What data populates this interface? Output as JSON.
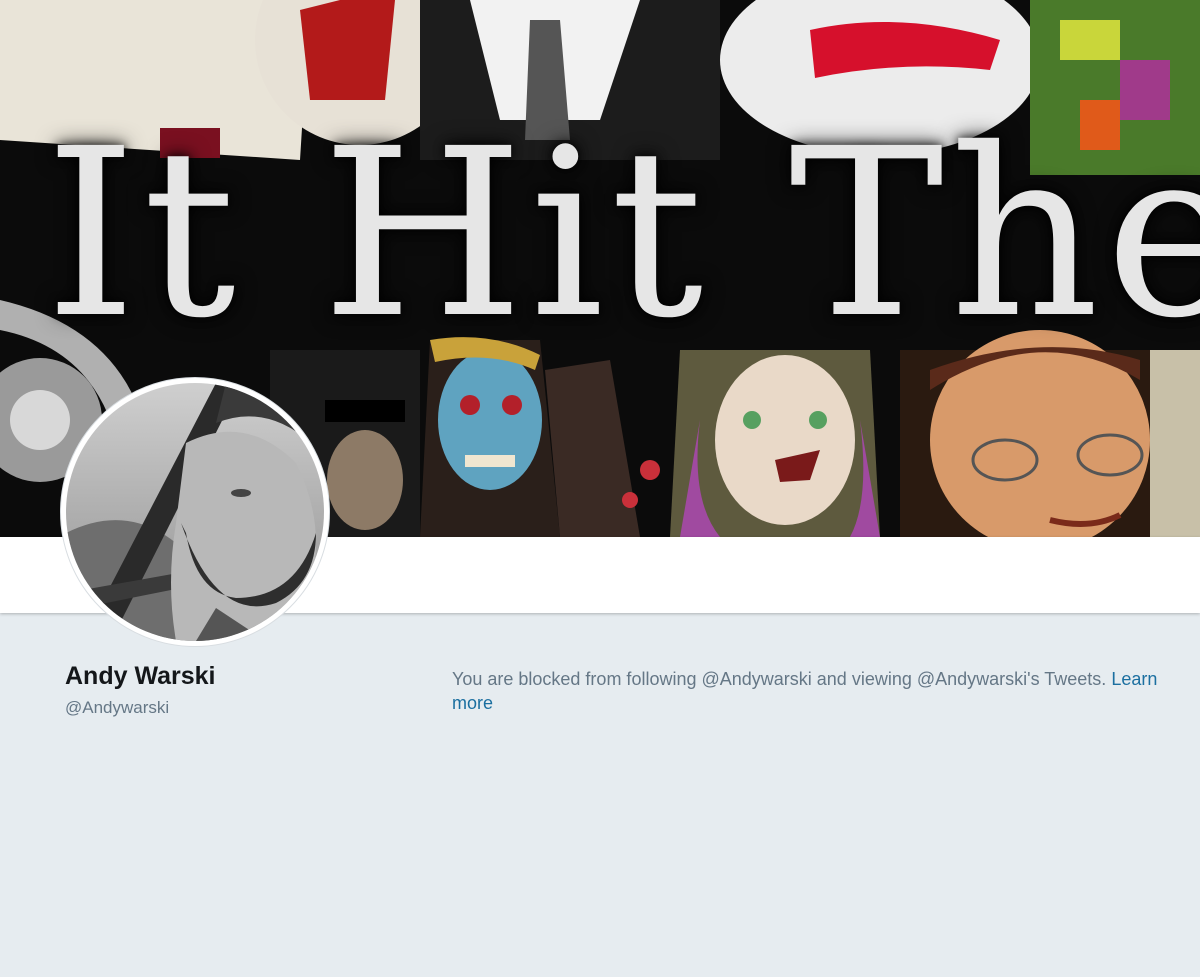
{
  "banner": {
    "text": "It Hit The"
  },
  "profile": {
    "name": "Andy Warski",
    "handle": "@Andywarski"
  },
  "blocked_notice": {
    "message": "You are blocked from following @Andywarski and viewing @Andywarski's Tweets.",
    "link_label": "Learn more"
  },
  "colors": {
    "page_background": "#e6ecf0",
    "link": "#1b6fa0",
    "secondary_text": "#657786",
    "primary_text": "#14171a"
  }
}
